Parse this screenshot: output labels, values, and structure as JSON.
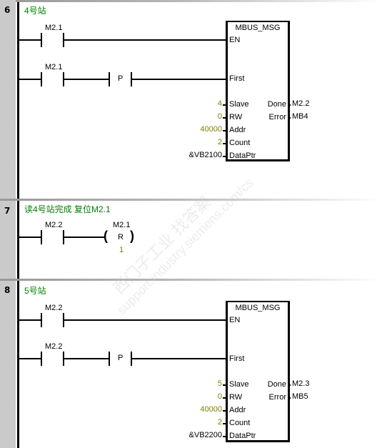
{
  "networks": [
    {
      "number": "6",
      "title": "4号站",
      "contact1": "M2.1",
      "contact2": "M2.1",
      "edge": "P",
      "block": {
        "name": "MBUS_MSG",
        "inputs": {
          "en": "EN",
          "first": "First",
          "slave": "Slave",
          "rw": "RW",
          "addr": "Addr",
          "count": "Count",
          "dataptr": "DataPtr"
        },
        "input_values": {
          "slave": "4",
          "rw": "0",
          "addr": "40000",
          "count": "2",
          "dataptr": "&VB2100"
        },
        "outputs": {
          "done": "Done",
          "error": "Error"
        },
        "output_values": {
          "done": "M2.2",
          "error": "MB4"
        }
      }
    },
    {
      "number": "7",
      "title": "读4号站完成 复位M2.1",
      "contact1": "M2.2",
      "coil_address": "M2.1",
      "coil_type": "R",
      "coil_count": "1",
      "coil_open": "(",
      "coil_close": ")"
    },
    {
      "number": "8",
      "title": "5号站",
      "contact1": "M2.2",
      "contact2": "M2.2",
      "edge": "P",
      "block": {
        "name": "MBUS_MSG",
        "inputs": {
          "en": "EN",
          "first": "First",
          "slave": "Slave",
          "rw": "RW",
          "addr": "Addr",
          "count": "Count",
          "dataptr": "DataPtr"
        },
        "input_values": {
          "slave": "5",
          "rw": "0",
          "addr": "40000",
          "count": "2",
          "dataptr": "&VB2200"
        },
        "outputs": {
          "done": "Done",
          "error": "Error"
        },
        "output_values": {
          "done": "M2.3",
          "error": "MB5"
        }
      }
    }
  ],
  "watermark": {
    "line1": "西门子工业  找答案",
    "line2": "support.industry.siemens.com/cs"
  },
  "colors": {
    "comment": "#008000",
    "constant": "#808000",
    "rail": "#000000"
  }
}
